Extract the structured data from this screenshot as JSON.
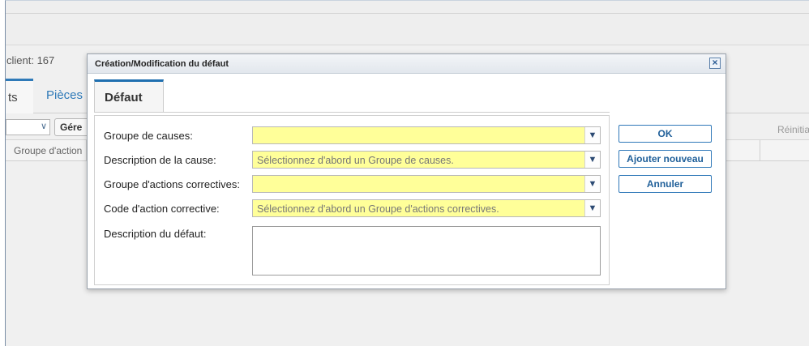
{
  "background": {
    "client_line": "client: 167",
    "tabs": [
      "ts",
      "Pièces"
    ],
    "toolbar_button": "Gére",
    "reset_label": "Réinitia",
    "grid_header": "Groupe d'action"
  },
  "dialog": {
    "title": "Création/Modification du défaut",
    "close_symbol": "×",
    "tab_label": "Défaut",
    "fields": [
      {
        "label": "Groupe de causes:",
        "value": ""
      },
      {
        "label": "Description de la cause:",
        "placeholder": "Sélectionnez d'abord un Groupe de causes."
      },
      {
        "label": "Groupe d'actions correctives:",
        "value": ""
      },
      {
        "label": "Code d'action corrective:",
        "placeholder": "Sélectionnez d'abord un Groupe d'actions correctives."
      }
    ],
    "description_label": "Description du défaut:",
    "description_value": "",
    "buttons": {
      "ok": "OK",
      "add_new": "Ajouter nouveau",
      "cancel": "Annuler"
    },
    "colors": {
      "field_background": "#ffff99",
      "accent": "#1f6fb0"
    }
  }
}
